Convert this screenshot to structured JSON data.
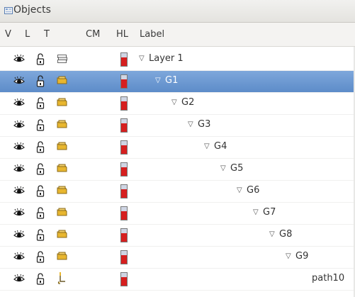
{
  "window": {
    "title": "Objects"
  },
  "columns": [
    "V",
    "L",
    "T",
    "CM",
    "HL",
    "Label"
  ],
  "icons": {
    "visible": "eye-icon",
    "lock": "unlocked-padlock-icon",
    "layer": "layer-stack-icon",
    "group": "group-folder-icon",
    "path": "path-tool-icon",
    "highlight": "highlight-color-swatch-icon",
    "expand": "expand-triangle-icon"
  },
  "colors": {
    "selection": "#6f9ad3",
    "highlight_red": "#d61f1f",
    "group_yellow": "#e8b62f"
  },
  "rows": [
    {
      "label": "Layer 1",
      "type": "layer",
      "level": 0,
      "expanded": true,
      "selected": false
    },
    {
      "label": "G1",
      "type": "group",
      "level": 1,
      "expanded": true,
      "selected": true
    },
    {
      "label": "G2",
      "type": "group",
      "level": 2,
      "expanded": true,
      "selected": false
    },
    {
      "label": "G3",
      "type": "group",
      "level": 3,
      "expanded": true,
      "selected": false
    },
    {
      "label": "G4",
      "type": "group",
      "level": 4,
      "expanded": true,
      "selected": false
    },
    {
      "label": "G5",
      "type": "group",
      "level": 5,
      "expanded": true,
      "selected": false
    },
    {
      "label": "G6",
      "type": "group",
      "level": 6,
      "expanded": true,
      "selected": false
    },
    {
      "label": "G7",
      "type": "group",
      "level": 7,
      "expanded": true,
      "selected": false
    },
    {
      "label": "G8",
      "type": "group",
      "level": 8,
      "expanded": true,
      "selected": false
    },
    {
      "label": "G9",
      "type": "group",
      "level": 9,
      "expanded": true,
      "selected": false
    },
    {
      "label": "path10",
      "type": "path",
      "level": 10,
      "expanded": false,
      "selected": false
    }
  ]
}
